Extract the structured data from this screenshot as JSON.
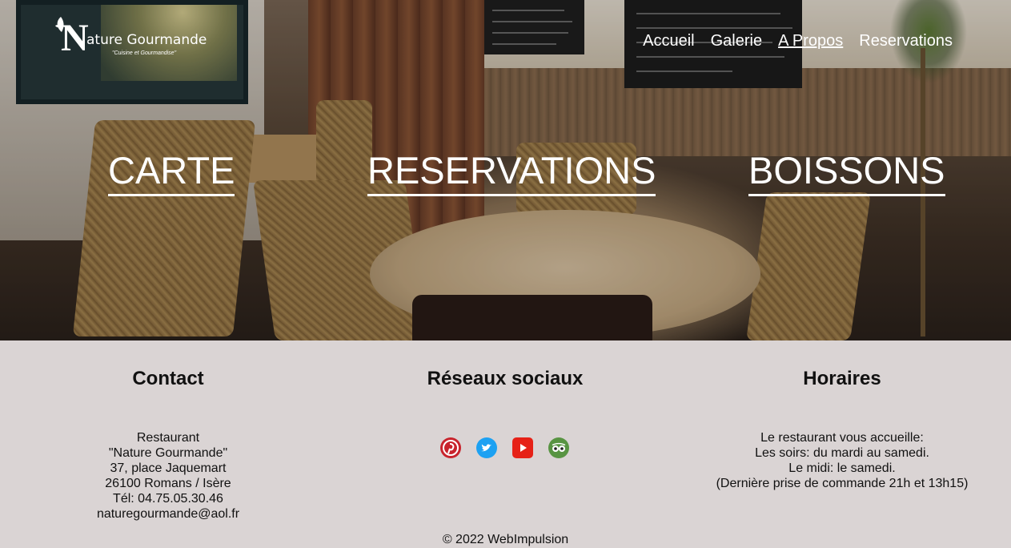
{
  "logo": {
    "initial": "N",
    "name": "ature Gourmande",
    "tagline": "\"Cuisine et Gourmandise\""
  },
  "nav": {
    "items": [
      {
        "label": "Accueil",
        "active": false
      },
      {
        "label": "Galerie",
        "active": false
      },
      {
        "label": "A Propos",
        "active": true
      },
      {
        "label": "Reservations",
        "active": false
      }
    ]
  },
  "hero": {
    "links": {
      "carte": "CARTE",
      "reservations": "RESERVATIONS",
      "boissons": "BOISSONS"
    }
  },
  "contact": {
    "title": "Contact",
    "lines": [
      "Restaurant",
      "\"Nature Gourmande\"",
      "37, place Jaquemart",
      "26100 Romans / Isère",
      "Tél: 04.75.05.30.46",
      "naturegourmande@aol.fr"
    ]
  },
  "social": {
    "title": "Réseaux sociaux",
    "icons": [
      {
        "name": "pinterest-icon",
        "color": "#c8232c"
      },
      {
        "name": "twitter-icon",
        "color": "#1da1f2"
      },
      {
        "name": "youtube-icon",
        "color": "#e62117"
      },
      {
        "name": "tripadvisor-icon",
        "color": "#589442"
      }
    ]
  },
  "hours": {
    "title": "Horaires",
    "lines": [
      "Le restaurant vous accueille:",
      "Les soirs: du mardi au samedi.",
      "Le midi: le samedi.",
      "(Dernière prise de commande 21h et 13h15)"
    ]
  },
  "footer": {
    "copyright": "© 2022 WebImpulsion"
  }
}
